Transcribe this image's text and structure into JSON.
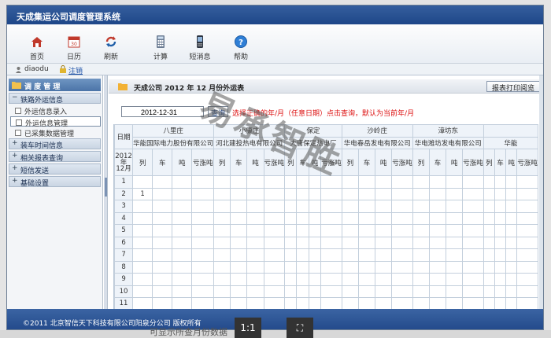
{
  "app": {
    "title": "天成集运公司调度管理系统"
  },
  "toolbar": {
    "items": [
      {
        "label": "首页",
        "icon": "home-icon"
      },
      {
        "label": "日历",
        "icon": "calendar-icon"
      },
      {
        "label": "刷新",
        "icon": "refresh-icon"
      },
      {
        "label": "计算",
        "icon": "calculator-icon"
      },
      {
        "label": "短消息",
        "icon": "phone-icon"
      },
      {
        "label": "帮助",
        "icon": "help-icon"
      }
    ]
  },
  "userbar": {
    "username": "diaodu",
    "logout_label": "注销"
  },
  "sidebar": {
    "header": "调 度 管 理",
    "groups": [
      {
        "label": "铁路外运信息"
      },
      {
        "label": "外运信息录入"
      },
      {
        "label": "外运信息管理"
      },
      {
        "label": "已采集数据管理"
      },
      {
        "label": "装车时间信息"
      },
      {
        "label": "相关报表查询"
      },
      {
        "label": "短信发送"
      },
      {
        "label": "基础设置"
      }
    ]
  },
  "main": {
    "title": "天成公司 2012 年 12 月份外运表",
    "print_label": "报表打印阅览",
    "date_value": "2012-12-31",
    "query_label": "查询",
    "tip": "选择正确的年/月（任意日期）点击查询，默认为当前年/月"
  },
  "grid": {
    "date_header": "日期",
    "year_month": [
      "2012",
      "年",
      "12",
      "月"
    ],
    "stations": [
      "八里庄",
      "小康庄",
      "保定",
      "沙岭庄",
      "漳坊东"
    ],
    "companies": [
      "华能国际电力股份有限公司",
      "河北建投热电有限公司",
      "大唐保定热电厂",
      "华电春岳发电有限公司",
      "华电潍坊发电有限公司",
      "华能"
    ],
    "col_labels": [
      "列",
      "车",
      "吨",
      "亏涨吨"
    ],
    "rows": [
      "1",
      "2",
      "3",
      "4",
      "5",
      "6",
      "7",
      "8",
      "9",
      "10",
      "11"
    ],
    "row1_value": "1"
  },
  "footer": {
    "text": "©2011   北京智信天下科技有限公司阳泉分公司    版权所有"
  },
  "watermark": "易承智胜",
  "viewer": {
    "caption": "可显示所查月份数据",
    "zoom_label": "1:1",
    "fit_label": "⛶"
  }
}
